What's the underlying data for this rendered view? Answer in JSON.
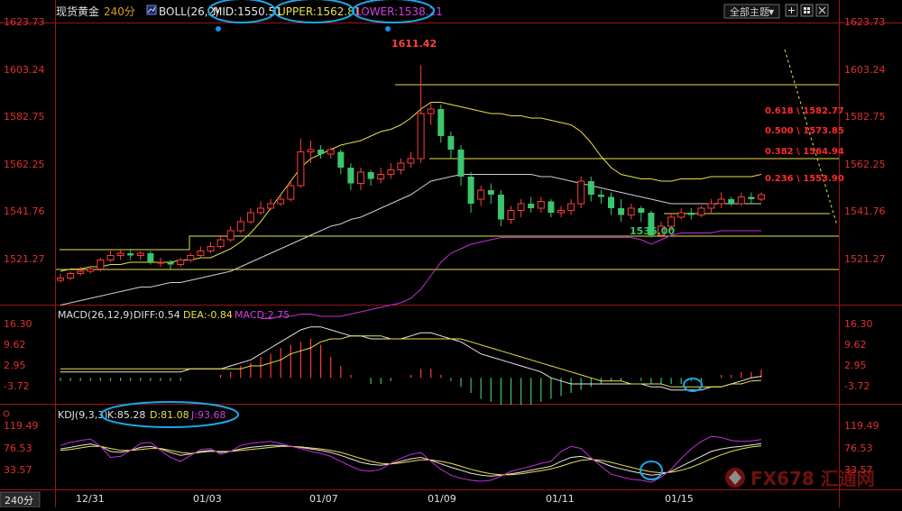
{
  "header": {
    "symbol": "现货黄金",
    "period": "240分",
    "indicator": "BOLL(26,2)",
    "mid": "MID:1550.51",
    "upper": "UPPER:1562.81",
    "lower": "LOWER:1538.21",
    "theme_button": "全部主题"
  },
  "macd_header": {
    "name": "MACD(26,12,9)",
    "diff": "DIFF:0.54",
    "dea": "DEA:-0.84",
    "macd": "MACD:2.75"
  },
  "kdj_header": {
    "name": "KDJ(9,3,3)",
    "k": "K:85.28",
    "d": "D:81.08",
    "j": "J:93.68"
  },
  "footer": {
    "period_badge": "240分"
  },
  "watermark": "FX678 汇通网",
  "colors": {
    "bg": "#000000",
    "up": "#ff3b3b",
    "down": "#3cc46e",
    "mid": "#cfcfcf",
    "upper": "#e8e04a",
    "lower": "#c030d8",
    "fib": "#ff2a2a",
    "axis": "#a01818"
  },
  "chart_data": [
    {
      "type": "candlestick",
      "x_labels": [
        "12/31",
        "01/03",
        "01/07",
        "01/09",
        "01/11",
        "01/15"
      ],
      "y_ticks": [
        "1623.73",
        "1603.24",
        "1582.75",
        "1562.25",
        "1541.76",
        "1521.27"
      ],
      "ylim": [
        1506,
        1630
      ],
      "price_annotations": {
        "high": "1611.42",
        "low": "1536.00"
      },
      "fibonacci": [
        "0.618 \\ 1582.77",
        "0.500 \\ 1573.85",
        "0.382 \\ 1564.94",
        "0.236 \\ 1553.90"
      ],
      "candles": [
        [
          1516,
          1517,
          1515,
          1519
        ],
        [
          1517,
          1519,
          1516,
          1520
        ],
        [
          1519,
          1520,
          1518,
          1522
        ],
        [
          1520,
          1521,
          1519,
          1522
        ],
        [
          1521,
          1525,
          1520,
          1526
        ],
        [
          1525,
          1527,
          1524,
          1529
        ],
        [
          1527,
          1528,
          1525,
          1530
        ],
        [
          1528,
          1527,
          1525,
          1530
        ],
        [
          1527,
          1528,
          1525,
          1529
        ],
        [
          1528,
          1524,
          1523,
          1529
        ],
        [
          1524,
          1524,
          1522,
          1526
        ],
        [
          1524,
          1523,
          1521,
          1525
        ],
        [
          1523,
          1525,
          1522,
          1526
        ],
        [
          1525,
          1527,
          1524,
          1528
        ],
        [
          1527,
          1529,
          1526,
          1531
        ],
        [
          1529,
          1531,
          1528,
          1533
        ],
        [
          1531,
          1534,
          1530,
          1536
        ],
        [
          1534,
          1538,
          1533,
          1540
        ],
        [
          1538,
          1542,
          1537,
          1544
        ],
        [
          1542,
          1546,
          1541,
          1548
        ],
        [
          1546,
          1548,
          1545,
          1551
        ],
        [
          1548,
          1550,
          1547,
          1552
        ],
        [
          1550,
          1552,
          1549,
          1554
        ],
        [
          1552,
          1558,
          1551,
          1560
        ],
        [
          1558,
          1573,
          1557,
          1579
        ],
        [
          1573,
          1574,
          1568,
          1578
        ],
        [
          1574,
          1572,
          1570,
          1576
        ],
        [
          1572,
          1574,
          1570,
          1575
        ],
        [
          1573,
          1566,
          1563,
          1574
        ],
        [
          1566,
          1559,
          1556,
          1568
        ],
        [
          1559,
          1564,
          1556,
          1566
        ],
        [
          1564,
          1561,
          1558,
          1565
        ],
        [
          1561,
          1563,
          1559,
          1566
        ],
        [
          1563,
          1565,
          1561,
          1568
        ],
        [
          1565,
          1568,
          1563,
          1570
        ],
        [
          1568,
          1570,
          1566,
          1573
        ],
        [
          1570,
          1590,
          1568,
          1611.42
        ],
        [
          1590,
          1592,
          1585,
          1595
        ],
        [
          1592,
          1580,
          1577,
          1594
        ],
        [
          1580,
          1574,
          1570,
          1582
        ],
        [
          1574,
          1562,
          1558,
          1576
        ],
        [
          1562,
          1550,
          1546,
          1564
        ],
        [
          1552,
          1556,
          1549,
          1558
        ],
        [
          1556,
          1554,
          1550,
          1559
        ],
        [
          1554,
          1543,
          1540,
          1556
        ],
        [
          1543,
          1547,
          1541,
          1549
        ],
        [
          1547,
          1550,
          1544,
          1552
        ],
        [
          1550,
          1548,
          1546,
          1553
        ],
        [
          1548,
          1551,
          1546,
          1553
        ],
        [
          1551,
          1546,
          1544,
          1552
        ],
        [
          1546,
          1547,
          1544,
          1549
        ],
        [
          1547,
          1550,
          1545,
          1552
        ],
        [
          1550,
          1560,
          1548,
          1562
        ],
        [
          1560,
          1554,
          1551,
          1562
        ],
        [
          1554,
          1553,
          1550,
          1556
        ],
        [
          1553,
          1548,
          1545,
          1555
        ],
        [
          1548,
          1545,
          1542,
          1552
        ],
        [
          1545,
          1548,
          1543,
          1550
        ],
        [
          1548,
          1546,
          1542,
          1549
        ],
        [
          1546,
          1536,
          1535,
          1547
        ],
        [
          1536,
          1540,
          1535,
          1542
        ],
        [
          1540,
          1544,
          1538,
          1546
        ],
        [
          1544,
          1546,
          1543,
          1548
        ],
        [
          1546,
          1545,
          1543,
          1548
        ],
        [
          1545,
          1548,
          1544,
          1549
        ],
        [
          1548,
          1550,
          1546,
          1552
        ],
        [
          1550,
          1552,
          1548,
          1555
        ],
        [
          1552,
          1550,
          1549,
          1553
        ],
        [
          1550,
          1553,
          1549,
          1555
        ],
        [
          1553,
          1552,
          1550,
          1555
        ],
        [
          1552,
          1554,
          1551,
          1555
        ]
      ],
      "series": [
        {
          "name": "UPPER",
          "values": [
            1520,
            1521,
            1521,
            1522,
            1522,
            1523,
            1523,
            1524,
            1524,
            1524,
            1524,
            1524,
            1525,
            1525,
            1526,
            1526,
            1528,
            1530,
            1533,
            1537,
            1542,
            1548,
            1554,
            1560,
            1566,
            1570,
            1572,
            1574,
            1576,
            1577,
            1578,
            1580,
            1582,
            1583,
            1585,
            1588,
            1592,
            1595,
            1595,
            1594,
            1593,
            1592,
            1591,
            1590,
            1590,
            1589,
            1589,
            1588,
            1588,
            1587,
            1586,
            1585,
            1582,
            1577,
            1571,
            1566,
            1563,
            1562,
            1561,
            1561,
            1560,
            1560,
            1561,
            1561,
            1561,
            1562,
            1562,
            1562,
            1562,
            1562,
            1563
          ]
        },
        {
          "name": "MID",
          "values": [
            1505,
            1506,
            1507,
            1508,
            1509,
            1510,
            1511,
            1512,
            1513,
            1513,
            1514,
            1515,
            1515,
            1516,
            1517,
            1518,
            1519,
            1520,
            1522,
            1524,
            1526,
            1528,
            1530,
            1532,
            1534,
            1536,
            1538,
            1540,
            1541,
            1543,
            1544,
            1546,
            1548,
            1550,
            1552,
            1554,
            1557,
            1560,
            1561,
            1562,
            1563,
            1563,
            1563,
            1563,
            1563,
            1563,
            1563,
            1563,
            1562,
            1562,
            1561,
            1560,
            1559,
            1558,
            1557,
            1556,
            1555,
            1554,
            1553,
            1552,
            1551,
            1550,
            1550,
            1550,
            1550,
            1550,
            1550,
            1550,
            1550,
            1550,
            1550
          ]
        },
        {
          "name": "LOWER",
          "values": [
            null,
            null,
            null,
            null,
            null,
            null,
            null,
            null,
            null,
            null,
            null,
            null,
            null,
            null,
            null,
            null,
            null,
            null,
            null,
            null,
            1499,
            1499,
            1500,
            1500,
            1501,
            1501,
            1500,
            1500,
            1500,
            1501,
            1502,
            1503,
            1504,
            1505,
            1506,
            1508,
            1512,
            1518,
            1524,
            1528,
            1530,
            1532,
            1533,
            1534,
            1535,
            1535,
            1535,
            1535,
            1535,
            1535,
            1535,
            1535,
            1535,
            1535,
            1535,
            1535,
            1535,
            1535,
            1534,
            1532,
            1534,
            1536,
            1537,
            1537,
            1537,
            1537,
            1538,
            1538,
            1538,
            1538,
            1538
          ]
        }
      ]
    },
    {
      "type": "bar+line",
      "name": "MACD(26,12,9)",
      "y_ticks": [
        "16.30",
        "9.62",
        "2.95",
        "-3.72"
      ],
      "ylim": [
        -8,
        19
      ],
      "series": [
        {
          "name": "DIFF",
          "values": [
            2,
            2,
            2,
            2,
            2,
            2,
            2,
            2,
            2,
            2,
            2,
            2,
            2,
            3,
            3,
            3,
            3,
            4,
            5,
            6,
            8,
            10,
            12,
            14,
            16,
            17,
            17,
            16,
            15,
            14,
            14,
            13,
            13,
            13,
            13,
            14,
            15,
            15,
            14,
            13,
            12,
            10,
            8,
            7,
            6,
            5,
            4,
            3,
            2,
            0,
            -1,
            -2,
            -2,
            -2,
            -2,
            -2,
            -2,
            -2,
            -2,
            -3,
            -3,
            -4,
            -4,
            -4,
            -4,
            -3,
            -3,
            -2,
            -1,
            0,
            0.54
          ]
        },
        {
          "name": "DEA",
          "values": [
            3,
            3,
            3,
            3,
            3,
            3,
            3,
            3,
            3,
            3,
            3,
            3,
            3,
            3,
            3,
            3,
            3,
            3,
            3,
            4,
            4,
            5,
            6,
            8,
            9,
            10,
            12,
            13,
            13,
            14,
            14,
            14,
            14,
            13,
            13,
            13,
            13,
            13,
            13,
            13,
            13,
            12,
            11,
            10,
            9,
            8,
            7,
            6,
            5,
            4,
            3,
            2,
            1,
            0,
            -1,
            -1,
            -1,
            -2,
            -2,
            -2,
            -2,
            -3,
            -3,
            -3,
            -3,
            -3,
            -3,
            -2,
            -2,
            -1,
            -0.84
          ]
        },
        {
          "name": "MACD",
          "values": [
            -1,
            -1,
            -1,
            -1,
            -1,
            -1,
            -1,
            -1,
            -1,
            -1,
            -1,
            -1,
            -1,
            0,
            0,
            0,
            1,
            2,
            4,
            5,
            7,
            8,
            10,
            11,
            12,
            13,
            11,
            7,
            4,
            1,
            0,
            -2,
            -2,
            -1,
            0,
            1,
            3,
            3,
            1,
            -1,
            -3,
            -5,
            -7,
            -8,
            -9,
            -9,
            -9,
            -9,
            -8,
            -7,
            -6,
            -5,
            -4,
            -3,
            -2,
            -1,
            -1,
            0,
            -1,
            -2,
            -2,
            -2,
            -2,
            -1,
            -1,
            0,
            1,
            1,
            2,
            2,
            2.75
          ]
        }
      ]
    },
    {
      "type": "line",
      "name": "KDJ(9,3,3)",
      "y_ticks": [
        "119.49",
        "76.53",
        "33.57"
      ],
      "ylim": [
        -10,
        135
      ],
      "series": [
        {
          "name": "K",
          "values": [
            75,
            78,
            82,
            85,
            80,
            70,
            68,
            72,
            78,
            80,
            75,
            68,
            62,
            65,
            70,
            72,
            68,
            70,
            75,
            78,
            80,
            82,
            82,
            80,
            78,
            75,
            72,
            68,
            62,
            55,
            48,
            44,
            42,
            45,
            50,
            55,
            58,
            52,
            45,
            38,
            32,
            26,
            22,
            20,
            22,
            25,
            28,
            32,
            36,
            40,
            50,
            58,
            60,
            55,
            48,
            40,
            35,
            30,
            26,
            22,
            24,
            30,
            40,
            50,
            60,
            70,
            75,
            78,
            80,
            83,
            85.28
          ]
        },
        {
          "name": "D",
          "values": [
            72,
            74,
            77,
            80,
            80,
            76,
            72,
            72,
            74,
            76,
            76,
            72,
            68,
            66,
            68,
            70,
            70,
            70,
            72,
            74,
            76,
            78,
            80,
            80,
            79,
            77,
            75,
            72,
            68,
            62,
            56,
            50,
            46,
            45,
            47,
            50,
            53,
            53,
            50,
            46,
            40,
            34,
            29,
            25,
            23,
            23,
            25,
            28,
            31,
            35,
            40,
            47,
            52,
            54,
            52,
            48,
            43,
            38,
            33,
            29,
            27,
            28,
            32,
            38,
            46,
            55,
            63,
            70,
            75,
            79,
            81.08
          ]
        },
        {
          "name": "J",
          "values": [
            82,
            88,
            92,
            95,
            80,
            58,
            60,
            72,
            86,
            88,
            72,
            58,
            50,
            62,
            74,
            76,
            64,
            70,
            82,
            86,
            88,
            90,
            86,
            80,
            76,
            70,
            66,
            60,
            50,
            40,
            32,
            30,
            34,
            46,
            56,
            64,
            68,
            50,
            34,
            22,
            16,
            12,
            10,
            12,
            20,
            30,
            35,
            40,
            46,
            50,
            70,
            80,
            76,
            57,
            40,
            24,
            19,
            14,
            12,
            8,
            18,
            34,
            56,
            75,
            90,
            100,
            98,
            92,
            90,
            91,
            93.68
          ]
        }
      ]
    }
  ]
}
